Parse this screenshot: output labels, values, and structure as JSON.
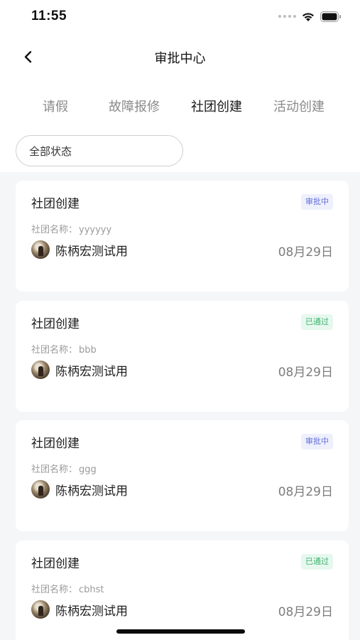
{
  "status_bar": {
    "time": "11:55"
  },
  "nav": {
    "title": "审批中心"
  },
  "tabs": [
    {
      "label": "请假",
      "active": false
    },
    {
      "label": "故障报修",
      "active": false
    },
    {
      "label": "社团创建",
      "active": true
    },
    {
      "label": "活动创建",
      "active": false
    }
  ],
  "filter": {
    "label": "全部状态"
  },
  "cards": [
    {
      "title": "社团创建",
      "status": "审批中",
      "status_type": "pending",
      "field_label": "社团名称：",
      "field_value": "yyyyyy",
      "user": "陈柄宏测试用",
      "date": "08月29日"
    },
    {
      "title": "社团创建",
      "status": "已通过",
      "status_type": "approved",
      "field_label": "社团名称：",
      "field_value": "bbb",
      "user": "陈柄宏测试用",
      "date": "08月29日"
    },
    {
      "title": "社团创建",
      "status": "审批中",
      "status_type": "pending",
      "field_label": "社团名称：",
      "field_value": "ggg",
      "user": "陈柄宏测试用",
      "date": "08月29日"
    },
    {
      "title": "社团创建",
      "status": "已通过",
      "status_type": "approved",
      "field_label": "社团名称：",
      "field_value": "cbhst",
      "user": "陈柄宏测试用",
      "date": "08月29日"
    }
  ],
  "colors": {
    "pending_badge": "#6670d6",
    "approved_badge": "#3cb371",
    "list_bg": "#f5f6f8"
  },
  "icons": {
    "back": "chevron-left-icon",
    "wifi": "wifi-icon",
    "battery": "battery-icon",
    "signal": "signal-icon"
  }
}
